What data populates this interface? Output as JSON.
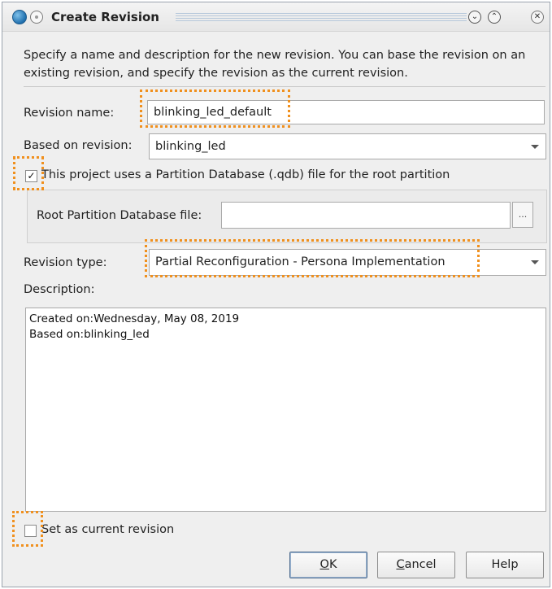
{
  "window": {
    "title": "Create Revision",
    "title_buttons": [
      "chevron-down-icon",
      "chevron-up-icon",
      "close-icon"
    ]
  },
  "intro_text": "Specify a name and description for the new revision. You can base the revision on an existing revision, and specify the revision as the current revision.",
  "revision_name": {
    "label": "Revision name:",
    "value": "blinking_led_default"
  },
  "based_on": {
    "label": "Based on revision:",
    "value": "blinking_led"
  },
  "partition_db": {
    "checkbox_label": "This project uses a Partition Database (.qdb) file for the root partition",
    "checked": true,
    "file_label": "Root Partition Database file:",
    "file_value": "",
    "browse_label": "..."
  },
  "revision_type": {
    "label": "Revision type:",
    "value": "Partial Reconfiguration - Persona Implementation"
  },
  "description": {
    "label": "Description:",
    "lines": [
      "Created on:Wednesday, May 08, 2019",
      "Based on:blinking_led"
    ]
  },
  "set_current": {
    "label": "Set as current revision",
    "checked": false
  },
  "buttons": {
    "ok_mnemonic": "O",
    "ok_rest": "K",
    "cancel_mnemonic": "C",
    "cancel_rest": "ancel",
    "help": "Help"
  },
  "colors": {
    "highlight": "#f0901e",
    "window_bg": "#efefef"
  }
}
